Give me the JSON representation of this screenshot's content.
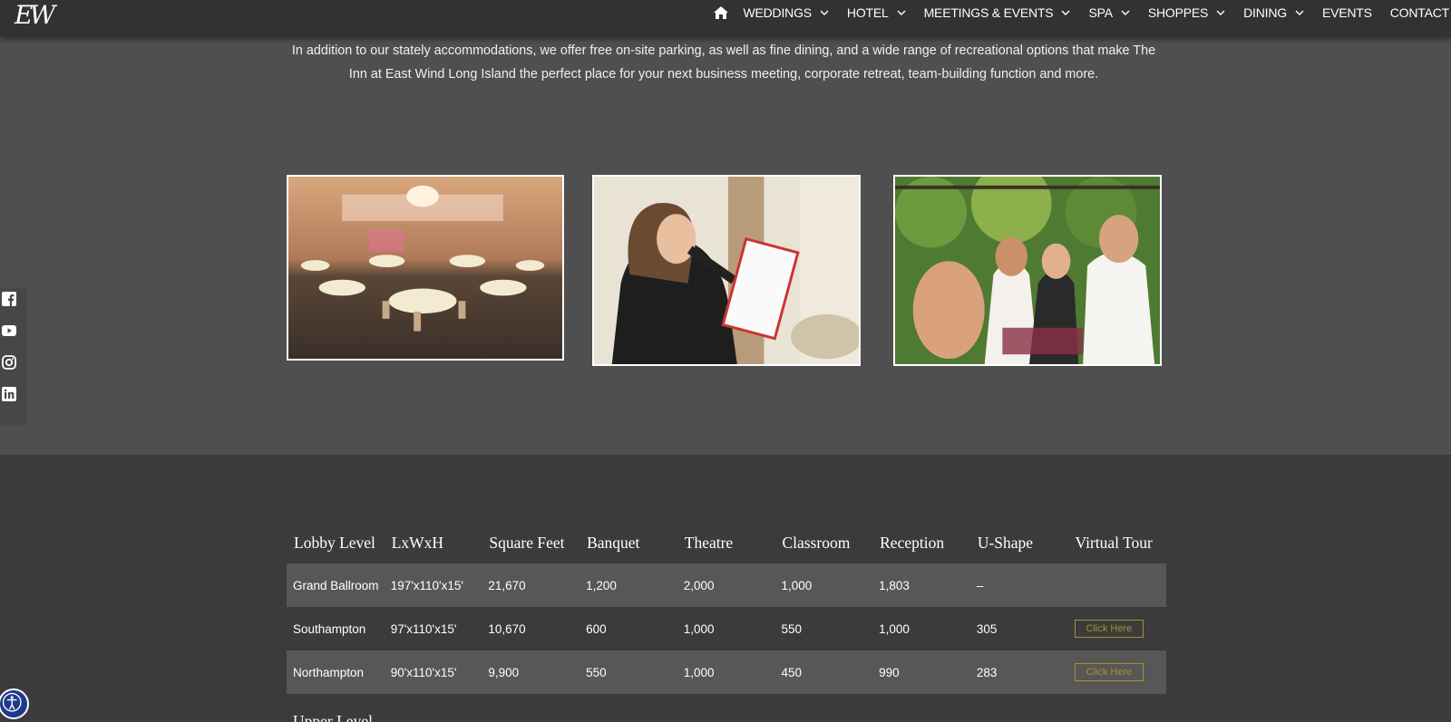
{
  "nav": {
    "logo": "EW",
    "items": [
      {
        "label": "WEDDINGS",
        "dropdown": true
      },
      {
        "label": "HOTEL",
        "dropdown": true
      },
      {
        "label": "MEETINGS & EVENTS",
        "dropdown": true
      },
      {
        "label": "SPA",
        "dropdown": true
      },
      {
        "label": "SHOPPES",
        "dropdown": true
      },
      {
        "label": "DINING",
        "dropdown": true
      },
      {
        "label": "EVENTS",
        "dropdown": false
      },
      {
        "label": "CONTACT",
        "dropdown": false
      }
    ]
  },
  "intro": {
    "text": "In addition to our stately accommodations, we offer free on-site parking, as well as fine dining, and a wide range of recreational options that make The Inn at East Wind Long Island the perfect place for your next business meeting, corporate retreat, team-building function and more."
  },
  "social": [
    "facebook-icon",
    "youtube-icon",
    "instagram-icon",
    "linkedin-icon"
  ],
  "table": {
    "headers": [
      "Lobby Level",
      "LxWxH",
      "Square Feet",
      "Banquet",
      "Theatre",
      "Classroom",
      "Reception",
      "U-Shape",
      "Virtual Tour"
    ],
    "rows": [
      [
        "Grand Ballroom",
        "197'x110'x15'",
        "21,670",
        "1,200",
        "2,000",
        "1,000",
        "1,803",
        "–",
        ""
      ],
      [
        "Southampton",
        "97'x110'x15'",
        "10,670",
        "600",
        "1,000",
        "550",
        "1,000",
        "305",
        "Click Here"
      ],
      [
        "Northampton",
        "90'x110'x15'",
        "9,900",
        "550",
        "1,000",
        "450",
        "990",
        "283",
        "Click Here"
      ]
    ],
    "next_section": "Upper Level"
  },
  "colors": {
    "nav_bg": "#323232",
    "page_bg": "#4f4f4f",
    "lower_bg": "#3b3b3b",
    "row_shade": "#575757",
    "accent_gold": "#a8912e"
  }
}
